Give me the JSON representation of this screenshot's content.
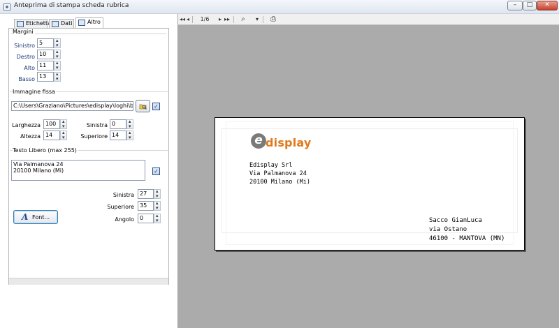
{
  "window": {
    "title": "Anteprima di stampa scheda rubrica",
    "minimize": "–",
    "maximize": "□",
    "close": "✕"
  },
  "tabs": [
    {
      "label": "Etichetta",
      "icon": "label-icon"
    },
    {
      "label": "Dati",
      "icon": "data-icon"
    },
    {
      "label": "Altro",
      "icon": "table-icon"
    }
  ],
  "margini": {
    "title": "Margini",
    "sinistro_label": "Sinistro",
    "sinistro_value": "5",
    "destro_label": "Destro",
    "destro_value": "10",
    "alto_label": "Alto",
    "alto_value": "11",
    "basso_label": "Basso",
    "basso_value": "13"
  },
  "immagine": {
    "title": "Immagine fissa",
    "path": "C:\\Users\\Graziano\\Pictures\\edisplay\\loghi\\bust",
    "checked": "✓",
    "larghezza_label": "Larghezza",
    "larghezza_value": "100",
    "altezza_label": "Altezza",
    "altezza_value": "14",
    "sinistra_label": "Sinistra",
    "sinistra_value": "0",
    "superiore_label": "Superiore",
    "superiore_value": "14"
  },
  "testo": {
    "title": "Testo Libero (max 255)",
    "line1": "Via Palmanova 24",
    "line2": "20100 Milano (Mi)",
    "checked": "✓",
    "sinistra_label": "Sinistra",
    "sinistra_value": "27",
    "superiore_label": "Superiore",
    "superiore_value": "35",
    "angolo_label": "Angolo",
    "angolo_value": "0",
    "font_button": "Font..."
  },
  "toolbar": {
    "page_indicator": "1/6",
    "first": "◂◂",
    "prev": "◂",
    "next": "▸",
    "last": "▸▸",
    "zoom_icon": "⌕",
    "zoom_dropdown": "▾",
    "print_icon": "⎙"
  },
  "preview": {
    "logo_e": "e",
    "logo_rest": "display",
    "sender": [
      "Edisplay Srl",
      "Via Palmanova 24",
      "20100 Milano (Mi)"
    ],
    "recipient": [
      "Sacco GianLuca",
      "via Ostano",
      "46100 - MANTOVA (MN)"
    ]
  },
  "colors": {
    "logo_orange": "#e07a1f",
    "logo_gray": "#7a7a7a",
    "preview_background": "#ababab"
  }
}
